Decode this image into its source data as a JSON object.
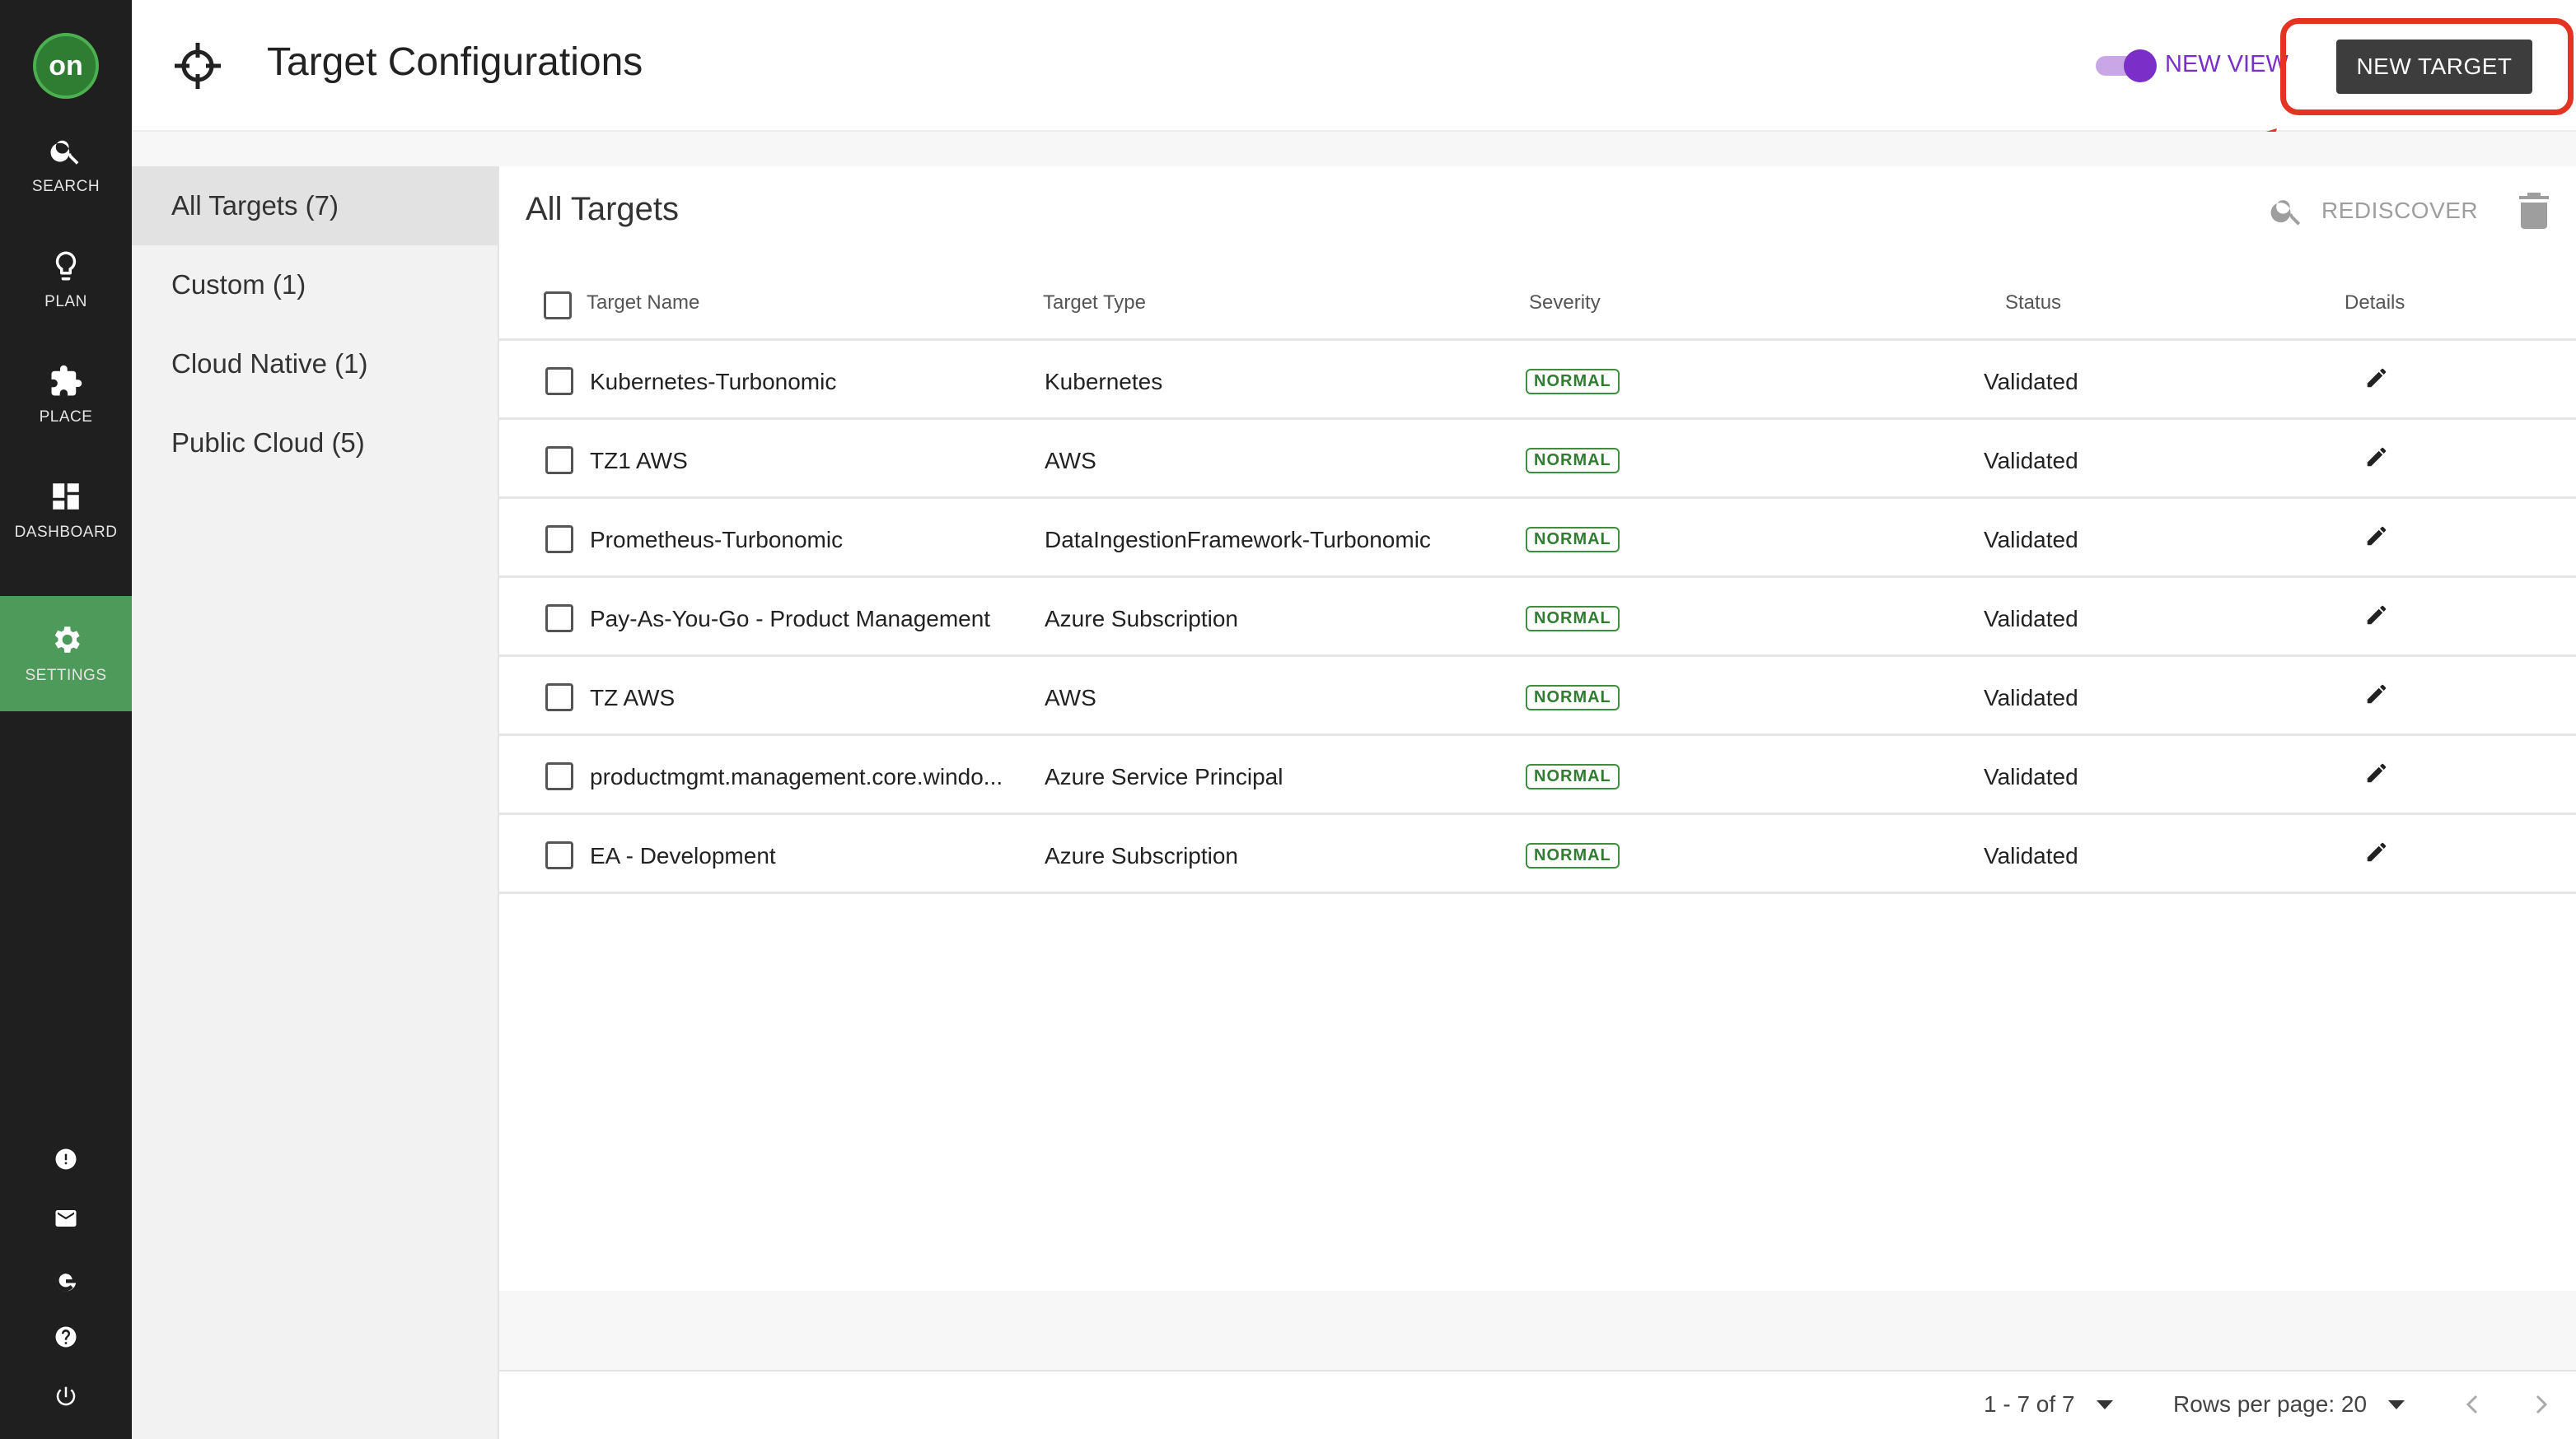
{
  "nav": {
    "logo_text": "on",
    "items": [
      {
        "label": "SEARCH",
        "icon": "search-icon"
      },
      {
        "label": "PLAN",
        "icon": "lightbulb-icon"
      },
      {
        "label": "PLACE",
        "icon": "puzzle-icon"
      },
      {
        "label": "DASHBOARD",
        "icon": "dashboard-icon"
      },
      {
        "label": "SETTINGS",
        "icon": "gear-icon"
      }
    ],
    "active": "SETTINGS",
    "bottom_icons": [
      "alert-icon",
      "mail-icon",
      "g-icon",
      "help-icon",
      "power-icon"
    ]
  },
  "header": {
    "title": "Target Configurations",
    "icon": "crosshair-icon",
    "toggle_label": "NEW VIEW",
    "toggle_on": true,
    "new_target_label": "NEW TARGET"
  },
  "categories": [
    {
      "label": "All Targets (7)",
      "active": true
    },
    {
      "label": "Custom (1)",
      "active": false
    },
    {
      "label": "Cloud Native (1)",
      "active": false
    },
    {
      "label": "Public Cloud (5)",
      "active": false
    }
  ],
  "main": {
    "title": "All Targets",
    "rediscover_label": "REDISCOVER",
    "columns": {
      "name": "Target Name",
      "type": "Target Type",
      "severity": "Severity",
      "status": "Status",
      "details": "Details"
    },
    "rows": [
      {
        "name": "Kubernetes-Turbonomic",
        "type": "Kubernetes",
        "severity": "NORMAL",
        "status": "Validated"
      },
      {
        "name": "TZ1 AWS",
        "type": "AWS",
        "severity": "NORMAL",
        "status": "Validated"
      },
      {
        "name": "Prometheus-Turbonomic",
        "type": "DataIngestionFramework-Turbonomic",
        "severity": "NORMAL",
        "status": "Validated"
      },
      {
        "name": "Pay-As-You-Go - Product Management",
        "type": "Azure Subscription",
        "severity": "NORMAL",
        "status": "Validated"
      },
      {
        "name": "TZ AWS",
        "type": "AWS",
        "severity": "NORMAL",
        "status": "Validated"
      },
      {
        "name": "productmgmt.management.core.windo...",
        "type": "Azure Service Principal",
        "severity": "NORMAL",
        "status": "Validated"
      },
      {
        "name": "EA - Development",
        "type": "Azure Subscription",
        "severity": "NORMAL",
        "status": "Validated"
      }
    ]
  },
  "pagination": {
    "range": "1 - 7 of 7",
    "rows_per_page": "Rows per page: 20"
  },
  "colors": {
    "nav_bg": "#1f1f1f",
    "nav_active": "#4e9a5b",
    "toggle_accent": "#7b2fc8",
    "badge_green": "#2e7d32",
    "annotation_red": "#e53323"
  }
}
